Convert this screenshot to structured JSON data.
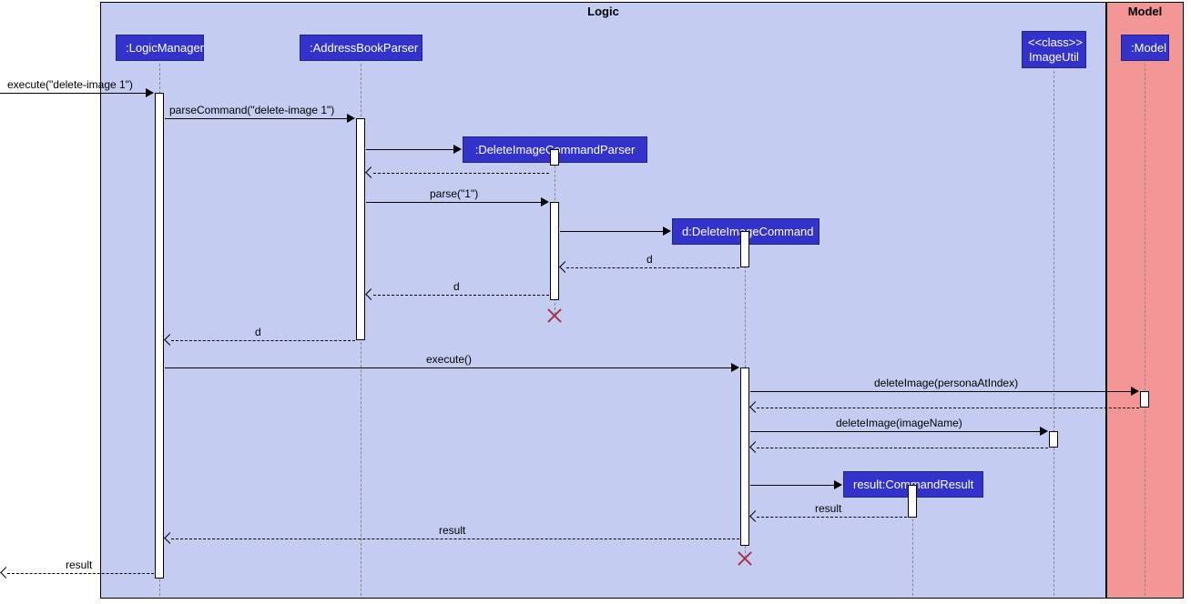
{
  "frames": {
    "logic": {
      "label": "Logic"
    },
    "model": {
      "label": "Model"
    }
  },
  "participants": {
    "logicManager": ":LogicManager",
    "addressBookParser": ":AddressBookParser",
    "deleteImageCommandParser": ":DeleteImageCommandParser",
    "deleteImageCommand": "d:DeleteImageCommand",
    "commandResult": "result:CommandResult",
    "imageUtil_line1": "<<class>>",
    "imageUtil_line2": "ImageUtil",
    "model": ":Model"
  },
  "messages": {
    "m1": "execute(\"delete-image 1\")",
    "m2": "parseCommand(\"delete-image 1\")",
    "m3": "parse(\"1\")",
    "m4": "d",
    "m5": "d",
    "m6": "d",
    "m7": "execute()",
    "m8": "deleteImage(personaAtIndex)",
    "m9": "deleteImage(imageName)",
    "m10": "result",
    "m11": "result",
    "m12": "result"
  }
}
